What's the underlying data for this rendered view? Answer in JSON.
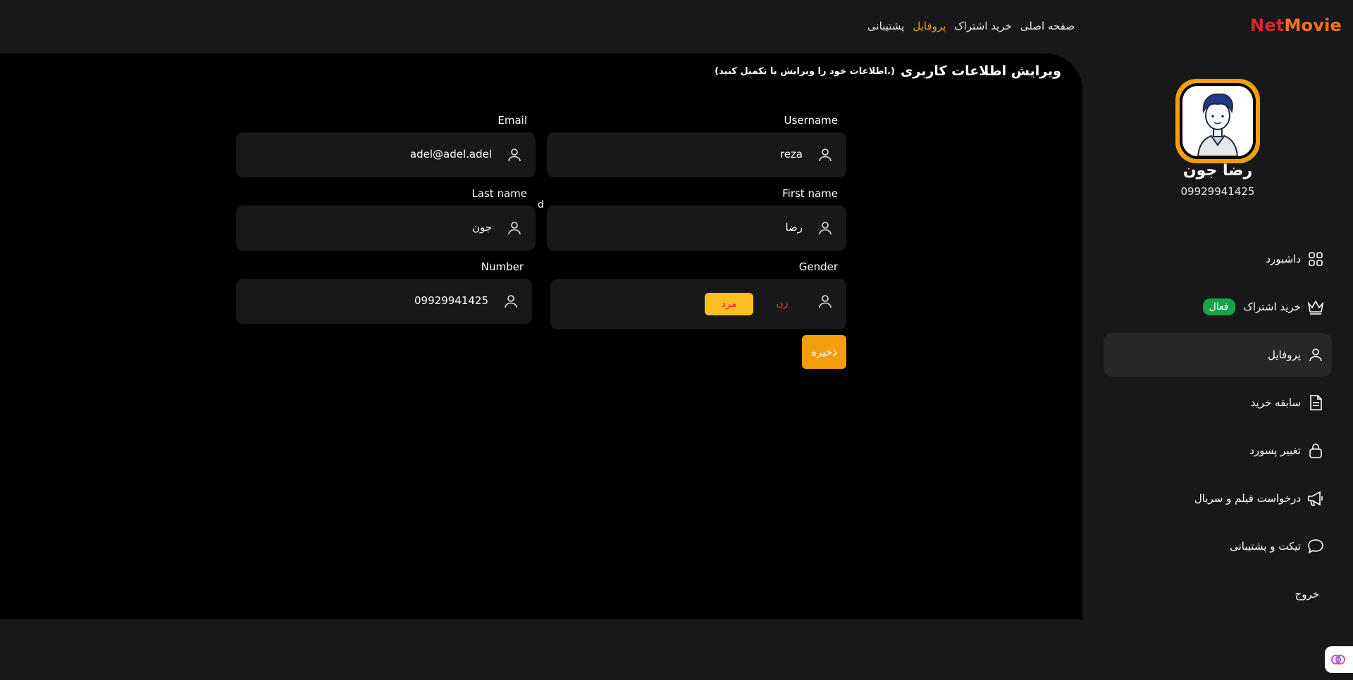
{
  "header": {
    "logo_part1": "Net",
    "logo_part2": "Movie",
    "nav": [
      "صفحه اصلی",
      "خرید اشتراک",
      "پروفایل",
      "پشتیبانی"
    ],
    "active_nav": "پروفایل"
  },
  "form": {
    "title": "ویرایش اطلاعات کاربری",
    "subtitle": "(اطلاعات خود را ویرایش یا تکمیل کنید.)",
    "username_label": "Username",
    "username_value": "reza",
    "email_label": "Email",
    "email_value": "adel@adel.adel",
    "firstname_label": "First name",
    "firstname_value": "رضا",
    "lastname_label": "Last name",
    "lastname_value": "جون",
    "gender_label": "Gender",
    "gender_female": "زن",
    "gender_male": "مرد",
    "number_label": "Number",
    "number_value": "09929941425",
    "stray_text": "d",
    "save_label": "ذخیره"
  },
  "profile": {
    "name": "رضا جون",
    "phone": "09929941425"
  },
  "sidebar": {
    "items": [
      {
        "label": "داشبورد",
        "icon": "dashboard-icon"
      },
      {
        "label": "خرید اشتراک",
        "icon": "crown-icon",
        "badge": "فعال"
      },
      {
        "label": "پروفایل",
        "icon": "user-icon"
      },
      {
        "label": "سابقه خرید",
        "icon": "document-icon"
      },
      {
        "label": "تغییر پسورد",
        "icon": "lock-icon"
      },
      {
        "label": "درخواست فیلم و سریال",
        "icon": "megaphone-icon"
      },
      {
        "label": "تیکت و پشتیبانی",
        "icon": "chat-icon"
      },
      {
        "label": "خروج",
        "icon": ""
      }
    ]
  },
  "colors": {
    "accent": "#f59e0b",
    "active_badge": "#16a34a",
    "logo_red": "#dc2626",
    "logo_orange": "#f97316"
  }
}
